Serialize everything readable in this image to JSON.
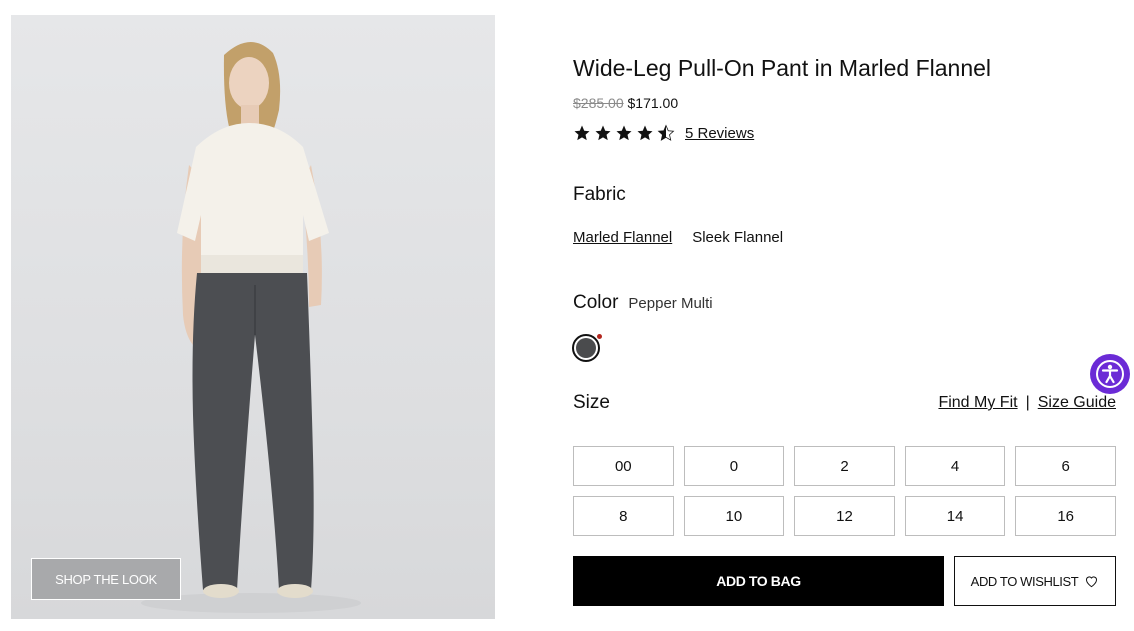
{
  "product": {
    "title": "Wide-Leg Pull-On Pant in Marled Flannel",
    "price_original": "$285.00",
    "price_sale": "$171.00",
    "rating": 4.5,
    "reviews_label": "5 Reviews"
  },
  "image": {
    "shop_the_look_label": "SHOP THE LOOK"
  },
  "fabric": {
    "label": "Fabric",
    "options": [
      "Marled Flannel",
      "Sleek Flannel"
    ],
    "selected": "Marled Flannel"
  },
  "color": {
    "label": "Color",
    "selected_name": "Pepper Multi",
    "swatch_hex": "#4a4b4d"
  },
  "size": {
    "label": "Size",
    "find_fit_label": "Find My Fit",
    "separator": "|",
    "size_guide_label": "Size Guide",
    "options": [
      "00",
      "0",
      "2",
      "4",
      "6",
      "8",
      "10",
      "12",
      "14",
      "16"
    ]
  },
  "actions": {
    "add_to_bag_label": "ADD TO BAG",
    "add_to_wishlist_label": "ADD TO WISHLIST"
  },
  "icons": {
    "heart": "heart-icon",
    "accessibility": "accessibility-icon",
    "star": "star-icon"
  },
  "colors": {
    "primary_button": "#000000",
    "accessibility_button": "#6b2bd6",
    "sale_badge_dot": "#b3261e"
  }
}
